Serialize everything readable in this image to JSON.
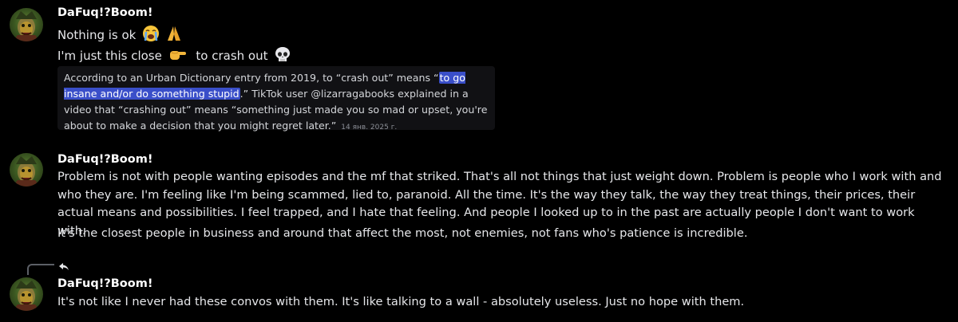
{
  "messages": [
    {
      "author": "DaFuq!?Boom!",
      "lines": [
        "Nothing is ok",
        "I'm just this close",
        "to crash out"
      ],
      "emojis": [
        "loudly-crying-face",
        "folded-hands",
        "pointing-finger",
        "skull"
      ],
      "quote": {
        "pre": "According to an Urban Dictionary entry from 2019, to “crash out” means “",
        "highlight": "to go insane and/or do something stupid",
        "post": ".” TikTok user @lizarragabooks explained in a video that “crashing out” means “something just made you so mad or upset, you're about to make a decision that you might regret later.”",
        "date": "14 янв. 2025 г."
      }
    },
    {
      "author": "DaFuq!?Boom!",
      "paragraph1": "Problem is not with people wanting episodes and the mf that striked. That's all not things that just weight down. Problem is people who I work with and who they are. I'm feeling like I'm being scammed, lied to, paranoid. All the time. It's the way they talk, the way they treat things, their prices, their actual means and possibilities. I feel trapped, and I hate that feeling. And people I looked up to in the past are actually people I don't want to work with.",
      "paragraph2": "It's the closest people in business and around that affect the most, not enemies, not fans who's patience is incredible."
    },
    {
      "author": "DaFuq!?Boom!",
      "text": "It's not like I never had these convos with them. It's like talking to a wall - absolutely useless. Just no hope with them."
    }
  ],
  "colors": {
    "background": "#000000",
    "highlight": "#3a4fc9",
    "quote_background": "#111114"
  }
}
